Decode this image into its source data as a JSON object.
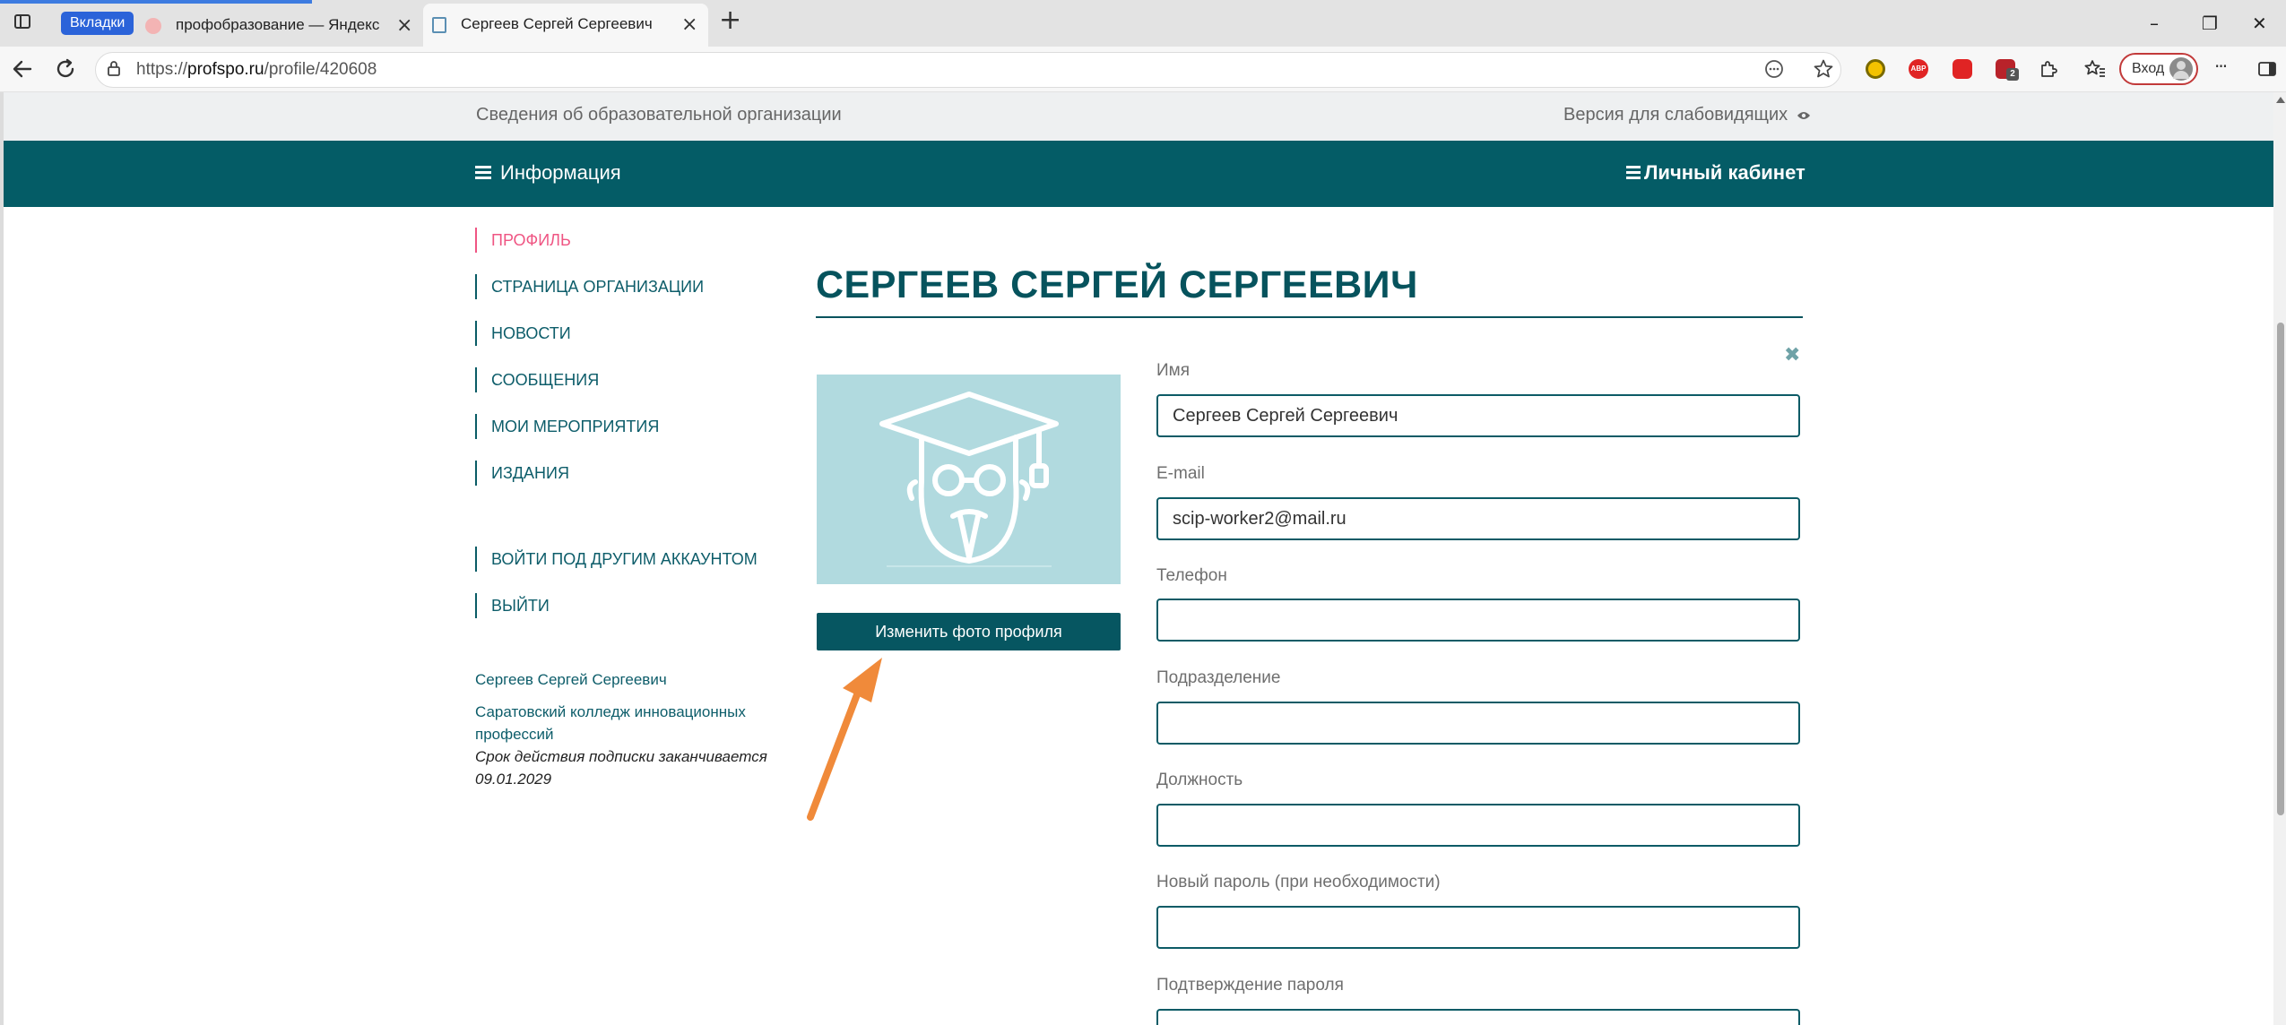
{
  "browser": {
    "tabs": [
      {
        "label": "Вкладки"
      },
      {
        "title": "профобразование — Яндекс: на"
      },
      {
        "title": "Сергеев Сергей Сергеевич"
      }
    ],
    "new_tab_glyph": "+",
    "window": {
      "minimize": "–",
      "restore": "❐",
      "close": "✕"
    },
    "url": {
      "prefix": "https://",
      "host": "profspo.ru",
      "path": "/profile/420608"
    },
    "extensions": [
      {
        "name": "yellow-circle-extension",
        "color": "#f3c200"
      },
      {
        "name": "adblock-extension",
        "label": "ABP",
        "color": "#e02424"
      },
      {
        "name": "shield-extension",
        "color": "#e02424"
      },
      {
        "name": "ublock-extension",
        "label": "2",
        "color": "#b8232a"
      }
    ],
    "login_label": "Вход",
    "more_glyph": "···"
  },
  "site": {
    "top_link": "Сведения об образовательной организации",
    "accessibility_link": "Версия для слабовидящих",
    "nav_info": "Информация",
    "nav_cabinet": "Личный кабинет",
    "menu": [
      "Профиль",
      "Страница организации",
      "Новости",
      "Сообщения",
      "Мои мероприятия",
      "Издания"
    ],
    "menu_active_color": "#ef5583",
    "account_menu": [
      "Войти под другим аккаунтом",
      "Выйти"
    ],
    "user_name": "Сергеев Сергей Сергеевич",
    "organization": "Саратовский колледж инновационных профессий",
    "subscription": "Срок действия подписки заканчивается 09.01.2029",
    "page_title": "СЕРГЕЕВ СЕРГЕЙ СЕРГЕЕВИЧ",
    "change_photo": "Изменить фото профиля",
    "fields": {
      "name": {
        "label": "Имя",
        "value": "Сергеев Сергей Сергеевич"
      },
      "email": {
        "label": "E-mail",
        "value": "scip-worker2@mail.ru"
      },
      "phone": {
        "label": "Телефон",
        "value": ""
      },
      "department": {
        "label": "Подразделение",
        "value": ""
      },
      "position": {
        "label": "Должность",
        "value": ""
      },
      "new_password": {
        "label": "Новый пароль (при необходимости)",
        "value": ""
      },
      "confirm_password": {
        "label": "Подтверждение пароля",
        "value": ""
      }
    },
    "close_glyph": "✖",
    "accent_color": "#045c66",
    "arrow_color": "#f08a3a"
  }
}
